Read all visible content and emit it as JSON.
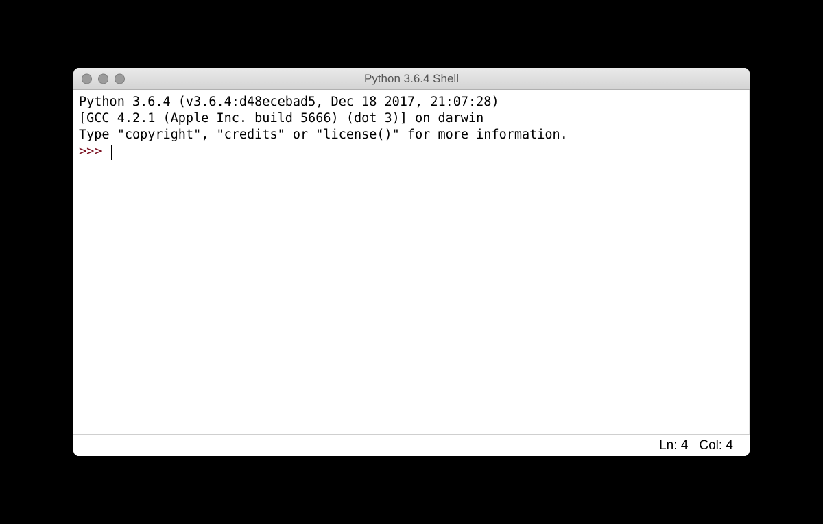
{
  "window": {
    "title": "Python 3.6.4 Shell"
  },
  "terminal": {
    "line1": "Python 3.6.4 (v3.6.4:d48ecebad5, Dec 18 2017, 21:07:28)",
    "line2": "[GCC 4.2.1 (Apple Inc. build 5666) (dot 3)] on darwin",
    "line3": "Type \"copyright\", \"credits\" or \"license()\" for more information.",
    "prompt": ">>> "
  },
  "status": {
    "line_label": "Ln: ",
    "line_value": "4",
    "col_label": "Col: ",
    "col_value": "4"
  }
}
